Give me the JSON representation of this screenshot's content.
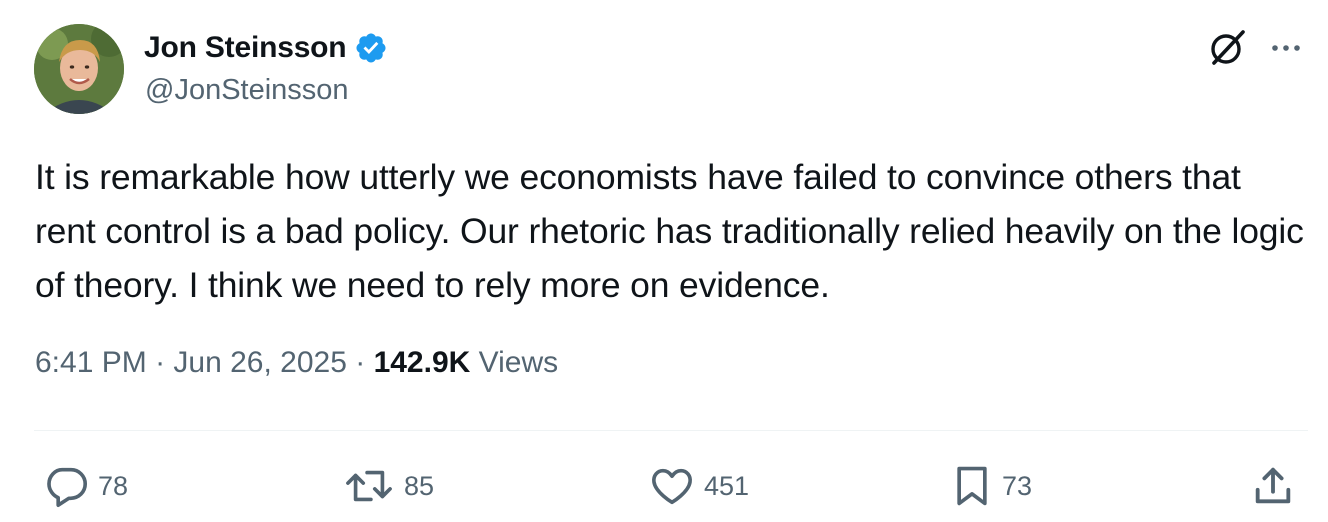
{
  "author": {
    "display_name": "Jon Steinsson",
    "handle": "@JonSteinsson",
    "verified": true
  },
  "tweet": {
    "text": "It is remarkable how utterly we economists have failed to convince others that rent control is a bad policy. Our rhetoric has traditionally relied heavily on the logic of theory. I think we need to rely more on evidence."
  },
  "meta": {
    "time": "6:41 PM",
    "separator": " · ",
    "date": "Jun 26, 2025",
    "views_count": "142.9K",
    "views_label": " Views"
  },
  "actions": {
    "replies": "78",
    "retweets": "85",
    "likes": "451",
    "bookmarks": "73"
  },
  "colors": {
    "verified_blue": "#1d9bf0",
    "text_primary": "#0f1419",
    "text_secondary": "#536471",
    "divider": "#eff3f4"
  },
  "icons": {
    "verified": "verified-badge-icon",
    "grok": "grok-icon",
    "more": "more-icon",
    "reply": "reply-icon",
    "retweet": "retweet-icon",
    "like": "heart-icon",
    "bookmark": "bookmark-icon",
    "share": "share-icon"
  }
}
